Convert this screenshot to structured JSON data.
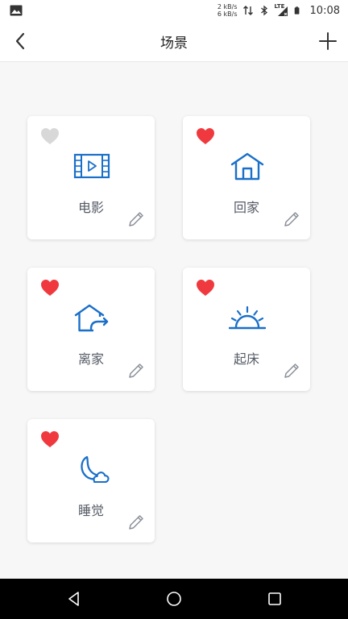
{
  "status_bar": {
    "netspeed_top": "2 kB/s",
    "netspeed_bottom": "6 kB/s",
    "network_label": "LTE",
    "time": "10:08"
  },
  "header": {
    "title": "场景",
    "back_icon": "chevron-left-icon",
    "add_icon": "plus-icon"
  },
  "colors": {
    "accent_blue": "#1a6fc9",
    "favorite_red": "#f0393e",
    "favorite_off": "#d8d8d8",
    "label_text": "#555b66"
  },
  "scenes": [
    {
      "label": "电影",
      "icon": "film-icon",
      "favorite": false
    },
    {
      "label": "回家",
      "icon": "home-icon",
      "favorite": true
    },
    {
      "label": "离家",
      "icon": "leave-home-icon",
      "favorite": true
    },
    {
      "label": "起床",
      "icon": "sunrise-icon",
      "favorite": true
    },
    {
      "label": "睡觉",
      "icon": "moon-cloud-icon",
      "favorite": true
    }
  ]
}
